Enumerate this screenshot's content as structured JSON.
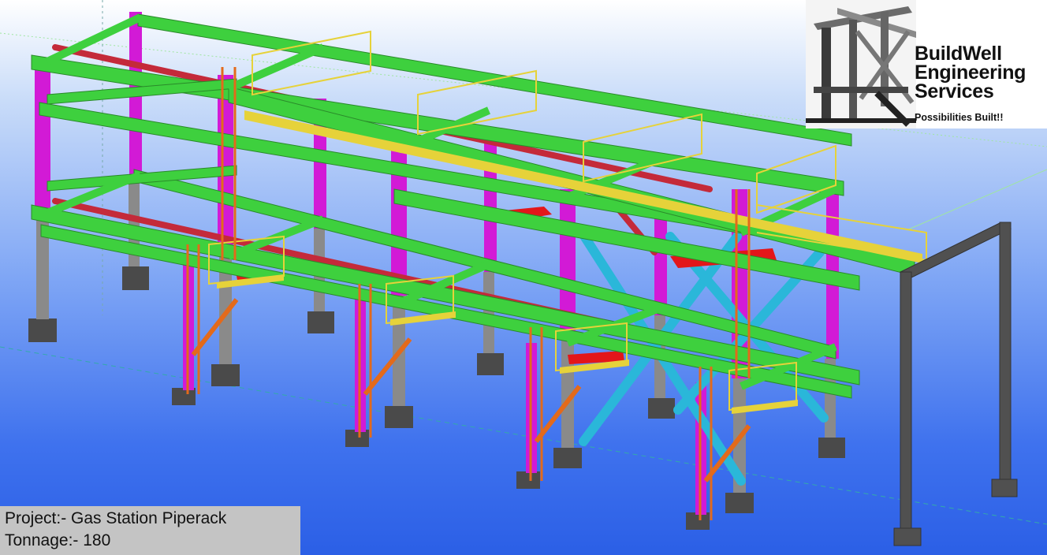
{
  "logo": {
    "brand_lines": [
      "BuildWell",
      "Engineering",
      "Services"
    ],
    "tagline": "Possibilities Built!!"
  },
  "info": {
    "project": "Project:- Gas Station Piperack",
    "tonnage": "Tonnage:- 180"
  },
  "colors": {
    "column": "#d21ad6",
    "beam": "#3ed03e",
    "handrail": "#e6d23a",
    "ladder": "#e36a1b",
    "bracing": "#2ab7d9",
    "pipe_beam": "#c42a3a",
    "base_plate": "#4a4a4a",
    "portal_frame": "#505050"
  }
}
